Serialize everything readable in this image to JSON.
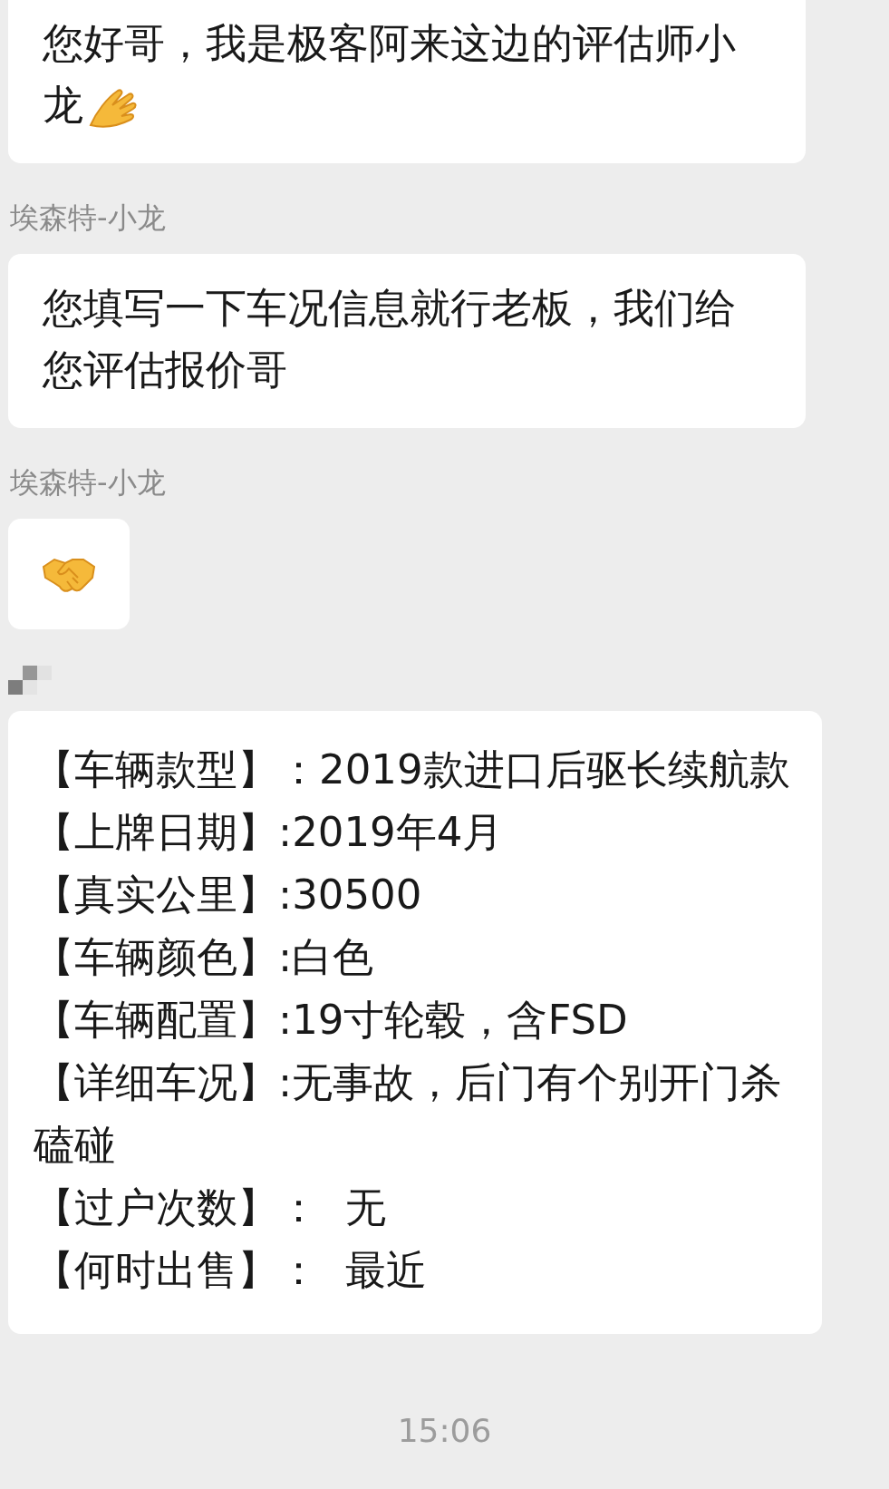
{
  "messages": [
    {
      "kind": "text",
      "text": "您好哥，我是极客阿来这边的评估师小龙"
    },
    {
      "kind": "text",
      "sender": "埃森特-小龙",
      "text": "您填写一下车况信息就行老板，我们给您评估报价哥"
    },
    {
      "kind": "emoji",
      "sender": "埃森特-小龙"
    },
    {
      "kind": "lines",
      "lines": [
        "【车辆款型】：2019款进口后驱长续航款",
        "【上牌日期】:2019年4月",
        "【真实公里】:30500",
        "【车辆颜色】:白色",
        "【车辆配置】:19寸轮毂，含FSD",
        "【详细车况】:无事故，后门有个别开门杀磕碰",
        "【过户次数】：  无",
        "【何时出售】：  最近"
      ]
    }
  ],
  "timestamp": "15:06"
}
